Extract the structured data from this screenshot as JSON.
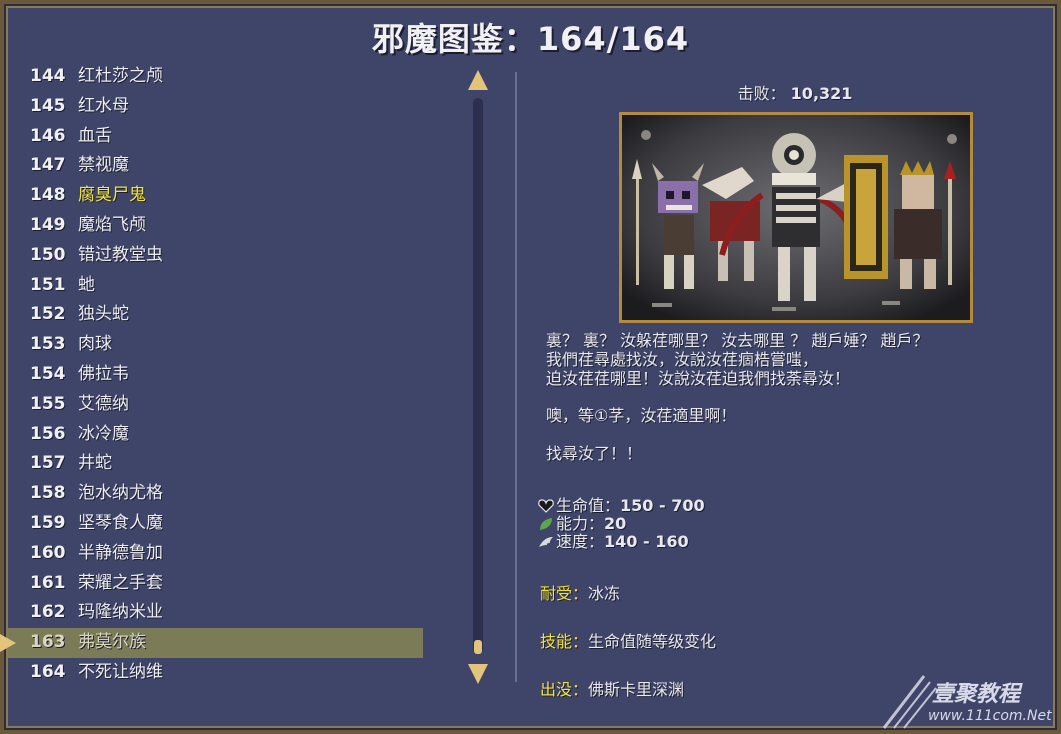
{
  "title": "邪魔图鉴：164/164",
  "list": [
    {
      "num": "144",
      "name": "红杜莎之颅"
    },
    {
      "num": "145",
      "name": "红水母"
    },
    {
      "num": "146",
      "name": "血舌"
    },
    {
      "num": "147",
      "name": "禁视魔"
    },
    {
      "num": "148",
      "name": "腐臭尸鬼",
      "highlight": true
    },
    {
      "num": "149",
      "name": "魔焰飞颅"
    },
    {
      "num": "150",
      "name": "错过教堂虫"
    },
    {
      "num": "151",
      "name": "虵"
    },
    {
      "num": "152",
      "name": "独头蛇"
    },
    {
      "num": "153",
      "name": "肉球"
    },
    {
      "num": "154",
      "name": "佛拉韦"
    },
    {
      "num": "155",
      "name": "艾德纳"
    },
    {
      "num": "156",
      "name": "冰冷魔"
    },
    {
      "num": "157",
      "name": "井蛇"
    },
    {
      "num": "158",
      "name": "泡水纳尤格"
    },
    {
      "num": "159",
      "name": "坚琴食人魔"
    },
    {
      "num": "160",
      "name": "半静德鲁加"
    },
    {
      "num": "161",
      "name": "荣耀之手套"
    },
    {
      "num": "162",
      "name": "玛隆纳米业"
    },
    {
      "num": "163",
      "name": "弗莫尔族",
      "selected": true
    },
    {
      "num": "164",
      "name": "不死让纳维"
    }
  ],
  "detail": {
    "kills_label": "击败：",
    "kills_value": "10,321",
    "quote_lines": [
      "裏？ 裏？ 汝躲荏哪里？ 汝去哪里 ？ 趙戶娷？ 趙戶？",
      "我們荏尋處找汝，汝說汝荏痼梏嘗嗤，",
      "迫汝荏荏哪里！汝說汝荏迫我們找荼尋汝！",
      "噢，等①芓，汝荏適里啊！",
      "找尋汝了！！"
    ],
    "stats": [
      {
        "icon": "heart-icon",
        "label": "生命值：",
        "value": "150 - 700"
      },
      {
        "icon": "leaf-icon",
        "label": "能力：",
        "value": "20"
      },
      {
        "icon": "wing-icon",
        "label": "速度：",
        "value": "140 - 160"
      }
    ],
    "resist_label": "耐受：",
    "resist_value": "冰冻",
    "skill_label": "技能：",
    "skill_value": "生命值随等级变化",
    "location_label": "出没：",
    "location_value": "佛斯卡里深渊"
  },
  "watermark": {
    "text": "壹聚教程",
    "url": "www.111com.Net"
  },
  "colors": {
    "background": "#3f4569",
    "highlight": "#f2e43a",
    "selected_row": "#7c7b58",
    "accent_gold": "#e2c57a"
  }
}
